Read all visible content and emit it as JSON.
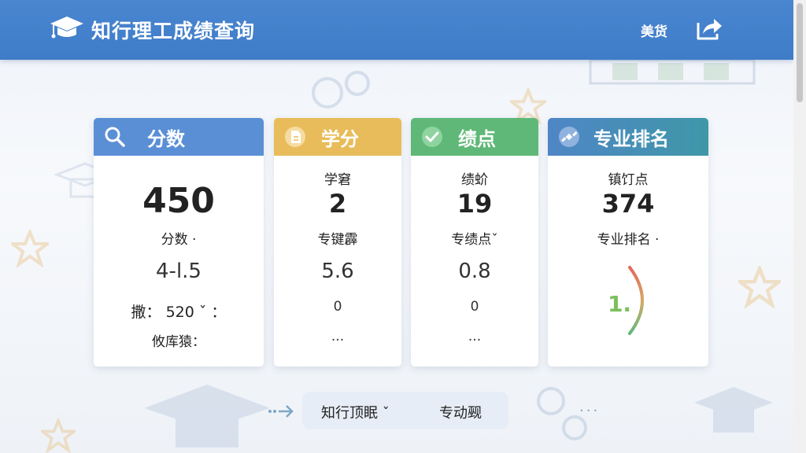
{
  "header": {
    "title": "知行理工成绩查询",
    "user": "美货",
    "share_icon": "share-icon",
    "logo_icon": "graduation-cap-icon",
    "color": "#4a86d0"
  },
  "cards": [
    {
      "title": "分数",
      "icon": "search-icon",
      "color": "#5a8fd6",
      "value": "450",
      "label": "分数 ·",
      "sub_value": "4-l.5",
      "extra1": "撒： 520 ˇ ：",
      "extra2": "攸库猿："
    },
    {
      "title": "学分",
      "icon": "document-icon",
      "color": "#e8bc5a",
      "top_label": "学窘",
      "value": "2",
      "label": "专键霹",
      "sub_value": "5.6",
      "extra1": "0",
      "extra2": "..."
    },
    {
      "title": "绩点",
      "icon": "check-icon",
      "color": "#5fb877",
      "top_label": "绩蚧",
      "value": "19",
      "label": "专绩点ˇ",
      "sub_value": "0.8",
      "extra1": "0",
      "extra2": "..."
    },
    {
      "title": "专业排名",
      "icon": "satellite-icon",
      "color": "#4f86c6",
      "top_label": "镇饤点",
      "value": "374",
      "label": "专业排名 ·",
      "gauge_value": "1."
    }
  ],
  "bottom": {
    "button1": "知行顶眠 ˇ",
    "button2": "专动觋",
    "dots": "···"
  }
}
